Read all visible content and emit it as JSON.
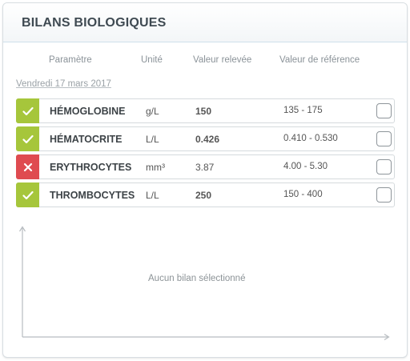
{
  "panel": {
    "title": "BILANS BIOLOGIQUES"
  },
  "columns": {
    "parameter": "Paramètre",
    "unit": "Unité",
    "value": "Valeur relevée",
    "reference": "Valeur de référence"
  },
  "date": "Vendredi 17 mars 2017",
  "rows": [
    {
      "status": "ok",
      "status_icon": "check-icon",
      "name": "HÉMOGLOBINE",
      "unit": "g/L",
      "value": "150",
      "reference": "135 - 175",
      "checked": false
    },
    {
      "status": "ok",
      "status_icon": "check-icon",
      "name": "HÉMATOCRITE",
      "unit": "L/L",
      "value": "0.426",
      "reference": "0.410 - 0.530",
      "checked": false
    },
    {
      "status": "bad",
      "status_icon": "cross-icon",
      "name": "ERYTHROCYTES",
      "unit": "mm³",
      "value": "3.87",
      "reference": "4.00 - 5.30",
      "checked": false
    },
    {
      "status": "ok",
      "status_icon": "check-icon",
      "name": "THROMBOCYTES",
      "unit": "L/L",
      "value": "250",
      "reference": "150 - 400",
      "checked": false
    }
  ],
  "chart": {
    "empty_message": "Aucun bilan sélectionné"
  },
  "colors": {
    "ok": "#a6c63b",
    "bad": "#df4b50",
    "header_border": "#cfe0ea"
  }
}
